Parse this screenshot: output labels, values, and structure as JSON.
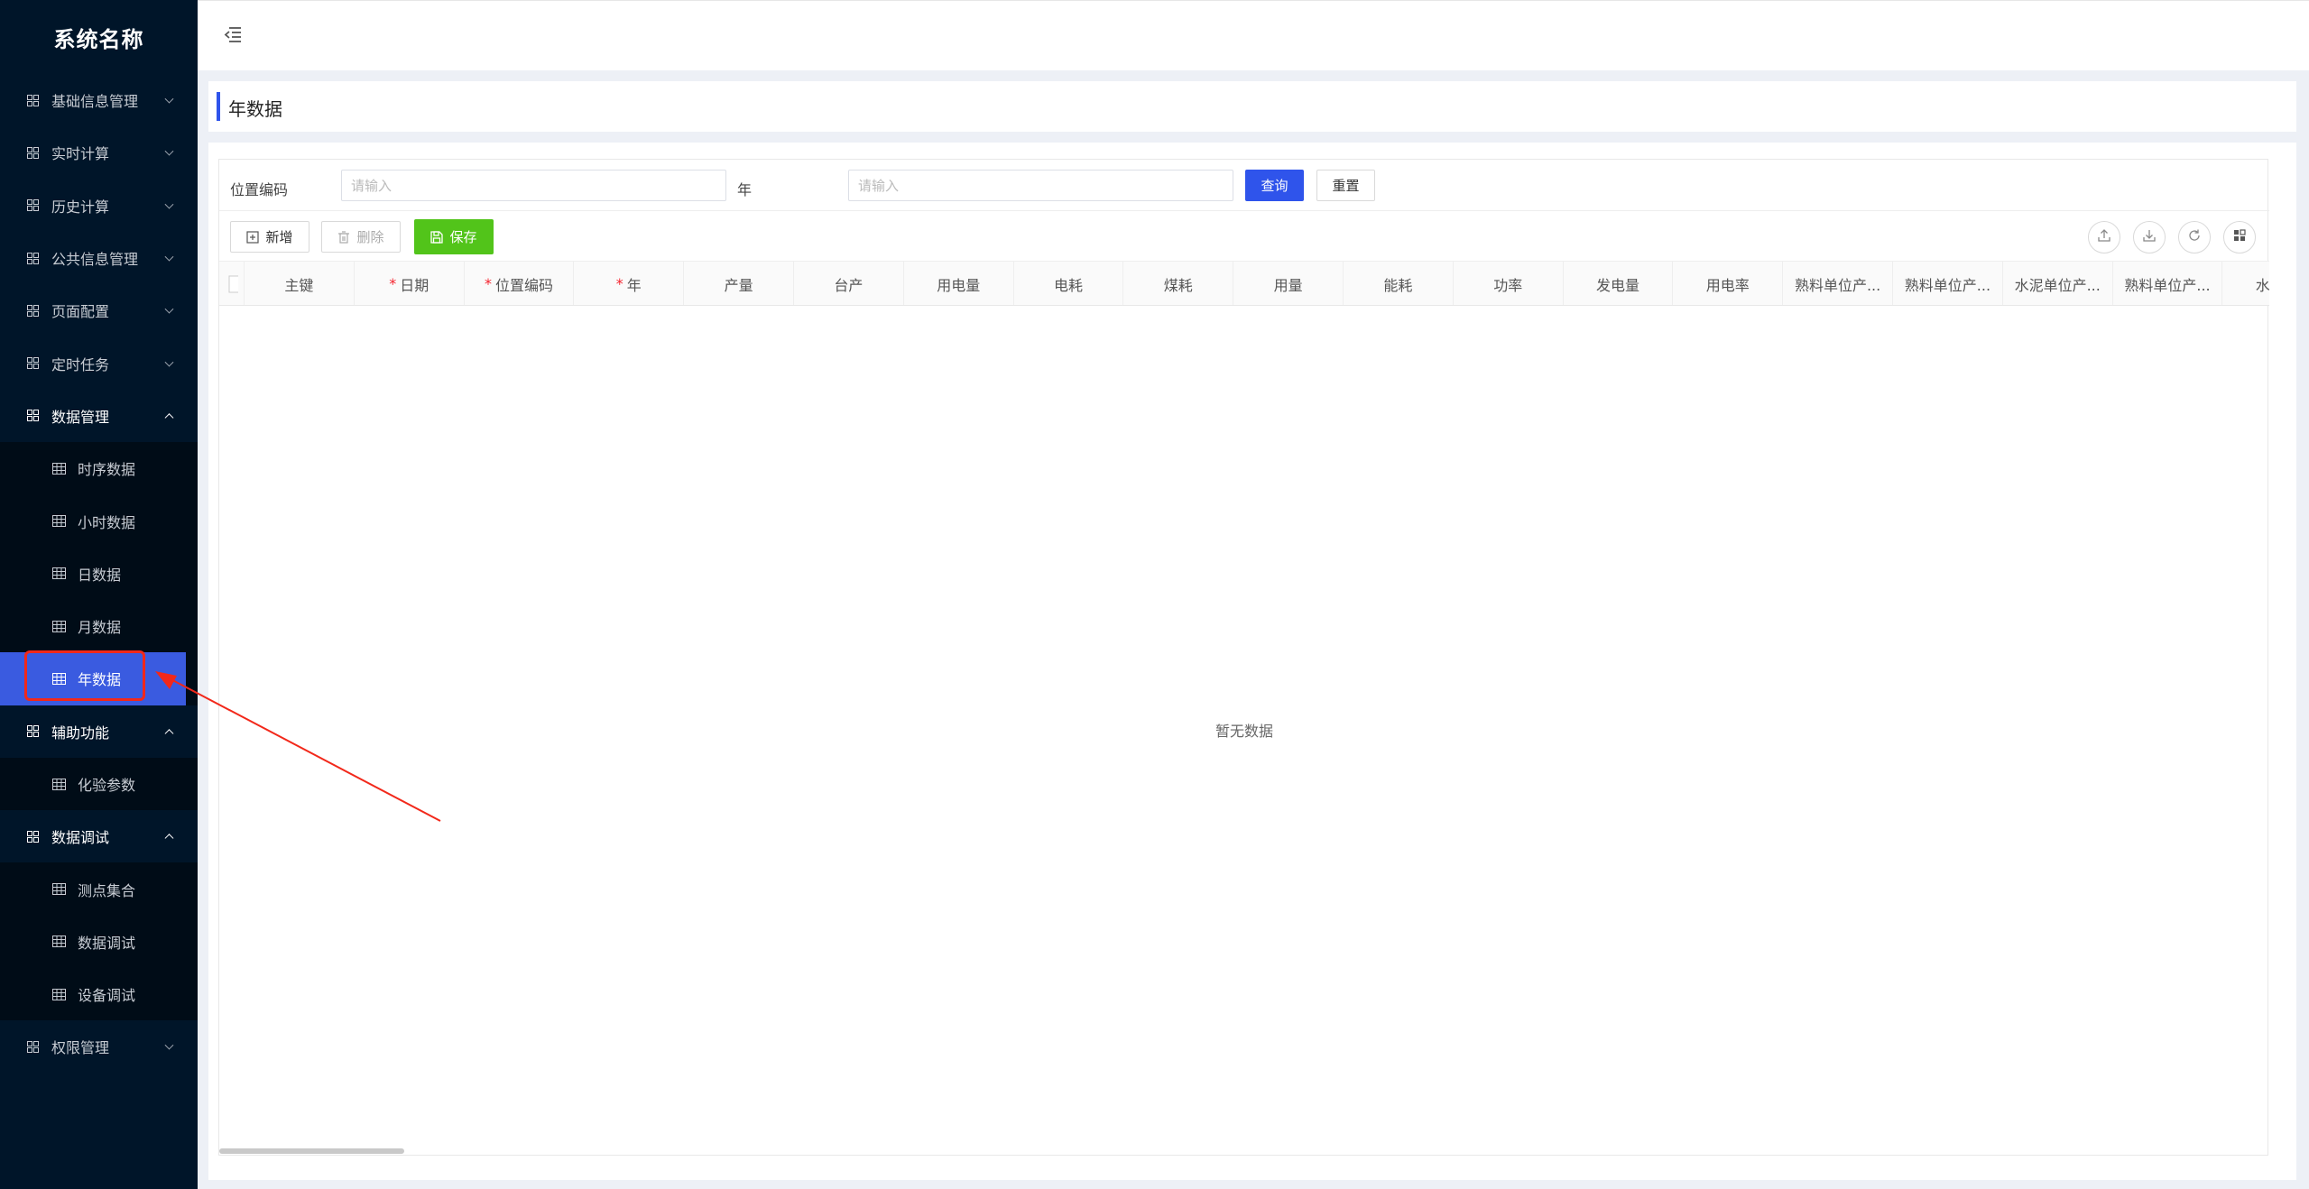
{
  "app": {
    "title": "系统名称"
  },
  "sidebar": {
    "items": [
      {
        "label": "基础信息管理",
        "level": 1,
        "expanded": false
      },
      {
        "label": "实时计算",
        "level": 1,
        "expanded": false
      },
      {
        "label": "历史计算",
        "level": 1,
        "expanded": false
      },
      {
        "label": "公共信息管理",
        "level": 1,
        "expanded": false
      },
      {
        "label": "页面配置",
        "level": 1,
        "expanded": false
      },
      {
        "label": "定时任务",
        "level": 1,
        "expanded": false
      },
      {
        "label": "数据管理",
        "level": 1,
        "expanded": true
      },
      {
        "label": "时序数据",
        "level": 2
      },
      {
        "label": "小时数据",
        "level": 2
      },
      {
        "label": "日数据",
        "level": 2
      },
      {
        "label": "月数据",
        "level": 2
      },
      {
        "label": "年数据",
        "level": 2,
        "active": true
      },
      {
        "label": "辅助功能",
        "level": 1,
        "expanded": true
      },
      {
        "label": "化验参数",
        "level": 2
      },
      {
        "label": "数据调试",
        "level": 1,
        "expanded": true
      },
      {
        "label": "测点集合",
        "level": 2
      },
      {
        "label": "数据调试",
        "level": 2
      },
      {
        "label": "设备调试",
        "level": 2
      },
      {
        "label": "权限管理",
        "level": 1,
        "expanded": false
      }
    ]
  },
  "page": {
    "title": "年数据"
  },
  "filter": {
    "location_label": "位置编码",
    "location_placeholder": "请输入",
    "year_label": "年",
    "year_placeholder": "请输入",
    "query_label": "查询",
    "reset_label": "重置"
  },
  "toolbar": {
    "add_label": "新增",
    "delete_label": "删除",
    "save_label": "保存"
  },
  "table": {
    "columns": [
      {
        "label": "主键",
        "required": false
      },
      {
        "label": "日期",
        "required": true
      },
      {
        "label": "位置编码",
        "required": true
      },
      {
        "label": "年",
        "required": true
      },
      {
        "label": "产量",
        "required": false
      },
      {
        "label": "台产",
        "required": false
      },
      {
        "label": "用电量",
        "required": false
      },
      {
        "label": "电耗",
        "required": false
      },
      {
        "label": "煤耗",
        "required": false
      },
      {
        "label": "用量",
        "required": false
      },
      {
        "label": "能耗",
        "required": false
      },
      {
        "label": "功率",
        "required": false
      },
      {
        "label": "发电量",
        "required": false
      },
      {
        "label": "用电率",
        "required": false
      },
      {
        "label": "熟料单位产...",
        "required": false
      },
      {
        "label": "熟料单位产...",
        "required": false
      },
      {
        "label": "水泥单位产...",
        "required": false
      },
      {
        "label": "熟料单位产...",
        "required": false
      },
      {
        "label": "水泥单",
        "required": false
      }
    ],
    "empty_text": "暂无数据"
  },
  "colors": {
    "sidebar_bg": "#001529",
    "accent": "#2f54eb",
    "success": "#52c41a",
    "highlight": "#f2281a"
  }
}
